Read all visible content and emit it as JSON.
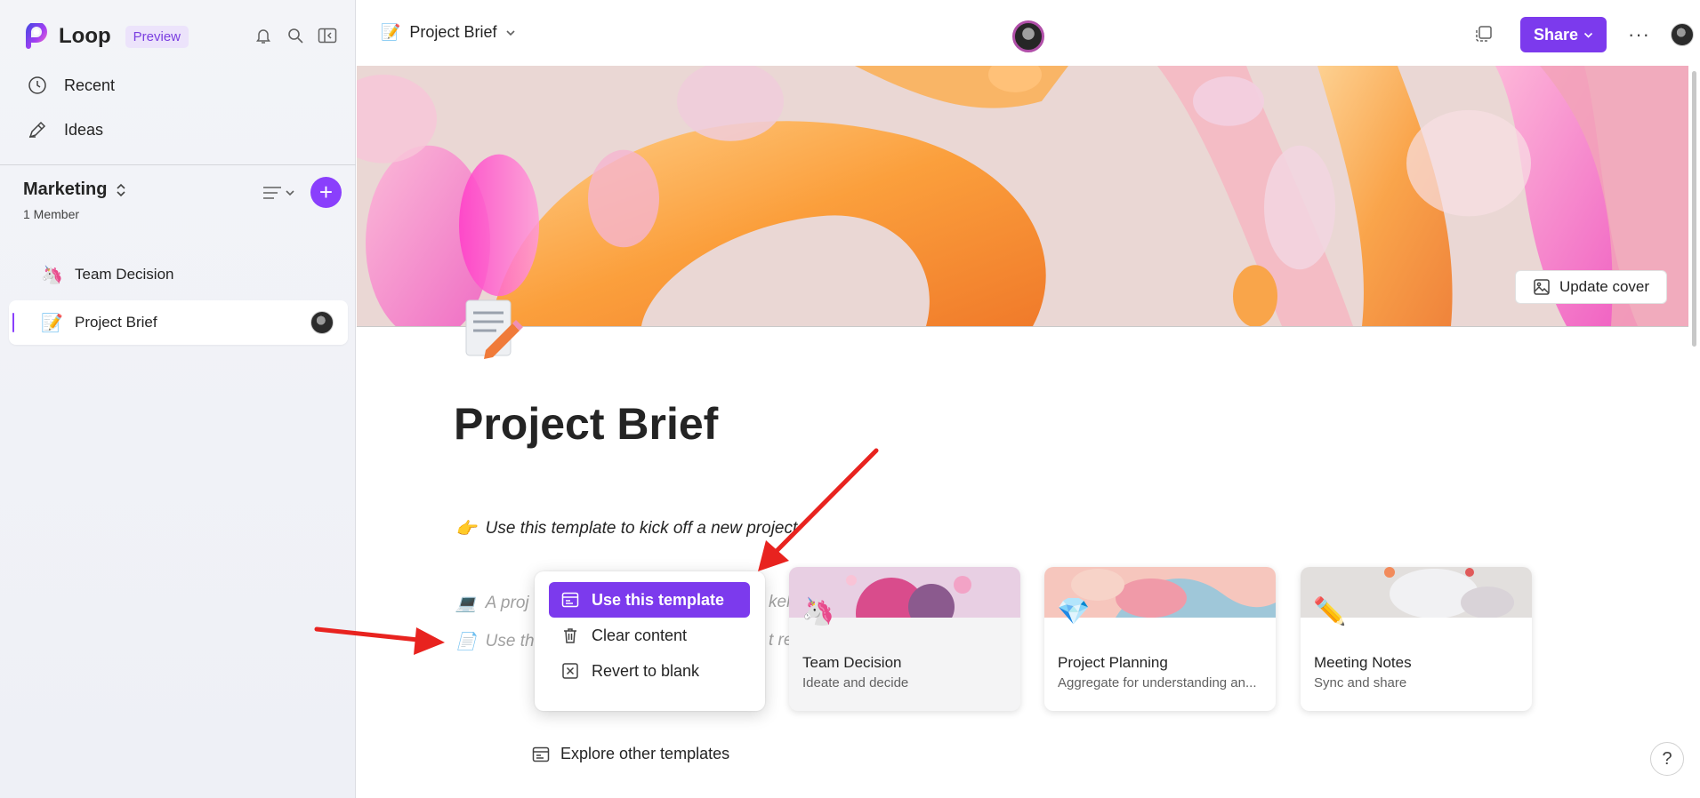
{
  "app": {
    "name": "Loop",
    "badge": "Preview"
  },
  "sidebar": {
    "nav": [
      {
        "label": "Recent",
        "icon": "clock-icon"
      },
      {
        "label": "Ideas",
        "icon": "pen-icon"
      }
    ],
    "workspace": {
      "name": "Marketing",
      "members": "1 Member"
    },
    "pages": [
      {
        "label": "Team Decision",
        "emoji": "🦄",
        "active": false
      },
      {
        "label": "Project Brief",
        "emoji": "📝",
        "active": true
      }
    ]
  },
  "header": {
    "breadcrumb": "Project Brief",
    "share_label": "Share",
    "more": "···"
  },
  "cover": {
    "update_label": "Update cover"
  },
  "document": {
    "title": "Project Brief",
    "lines": [
      {
        "emoji": "👉",
        "text": "Use this template to kick off a new project"
      },
      {
        "emoji": "💻",
        "text": "A proj"
      },
      {
        "emoji": "📄",
        "text": "Use th"
      }
    ],
    "hidden_fragments": [
      "keh",
      "t re"
    ]
  },
  "menu": {
    "items": [
      {
        "label": "Use this template",
        "icon": "template-icon"
      },
      {
        "label": "Clear content",
        "icon": "trash-icon"
      },
      {
        "label": "Revert to blank",
        "icon": "close-box-icon"
      }
    ]
  },
  "templates": [
    {
      "title": "Team Decision",
      "subtitle": "Ideate and decide",
      "emoji": "🦄"
    },
    {
      "title": "Project Planning",
      "subtitle": "Aggregate for understanding an...",
      "emoji": "💎"
    },
    {
      "title": "Meeting Notes",
      "subtitle": "Sync and share",
      "emoji": "✏️"
    }
  ],
  "explore_label": "Explore other templates",
  "help_label": "?",
  "colors": {
    "accent": "#7c3aed",
    "add_button": "#8a3ffc",
    "annotation_arrow": "#e8231f"
  }
}
